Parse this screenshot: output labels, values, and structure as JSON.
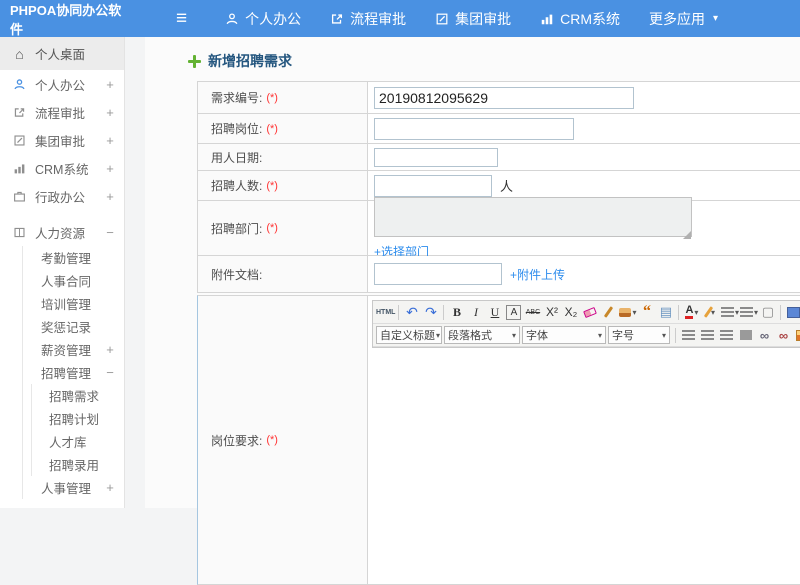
{
  "topbar": {
    "logo": "PHPOA协同办公软件",
    "nav": [
      {
        "label": "个人办公"
      },
      {
        "label": "流程审批"
      },
      {
        "label": "集团审批"
      },
      {
        "label": "CRM系统"
      },
      {
        "label": "更多应用"
      }
    ]
  },
  "icons": {
    "hamburger": "≡",
    "caret": "▾",
    "home": "⌂",
    "book": "⟙"
  },
  "sidebar": {
    "items": [
      {
        "label": "个人桌面"
      },
      {
        "label": "个人办公",
        "expand": "+"
      },
      {
        "label": "流程审批",
        "expand": "+"
      },
      {
        "label": "集团审批",
        "expand": "+"
      },
      {
        "label": "CRM系统",
        "expand": "+"
      },
      {
        "label": "行政办公",
        "expand": "+"
      },
      {
        "label": "人力资源",
        "expand": "−"
      },
      {
        "label": "考勤管理"
      },
      {
        "label": "人事合同"
      },
      {
        "label": "培训管理"
      },
      {
        "label": "奖惩记录"
      },
      {
        "label": "薪资管理",
        "expand": "+"
      },
      {
        "label": "招聘管理",
        "expand": "−"
      },
      {
        "label": "招聘需求"
      },
      {
        "label": "招聘计划"
      },
      {
        "label": "人才库"
      },
      {
        "label": "招聘录用"
      },
      {
        "label": "人事管理",
        "expand": "+"
      }
    ]
  },
  "page": {
    "title": "新增招聘需求"
  },
  "form": {
    "rows": [
      {
        "label": "需求编号:",
        "req": "(*)",
        "value": "20190812095629"
      },
      {
        "label": "招聘岗位:",
        "req": "(*)"
      },
      {
        "label": "用人日期:"
      },
      {
        "label": "招聘人数:",
        "req": "(*)",
        "suffix": "人"
      },
      {
        "label": "招聘部门:",
        "req": "(*)",
        "link": "+选择部门"
      },
      {
        "label": "附件文档:",
        "link": "+附件上传"
      },
      {
        "label": "岗位要求:",
        "req": "(*)"
      }
    ]
  },
  "editor": {
    "dropdowns": [
      {
        "label": "自定义标题"
      },
      {
        "label": "段落格式"
      },
      {
        "label": "字体"
      },
      {
        "label": "字号"
      }
    ],
    "icons": {
      "html": "HTML",
      "undo": "↶",
      "redo": "↷",
      "bold": "B",
      "italic": "I",
      "underline": "U",
      "fontbox": "A",
      "strike": "ABC",
      "sup": "X²",
      "sub": "X₂",
      "quote": "“",
      "template": "▤",
      "forecolor": "A",
      "page": "▢",
      "link": "∞",
      "unlink": "∞"
    }
  },
  "colors": {
    "topbar_blue": "#4a91e2",
    "title_navy": "#24567f",
    "required_red": "#ff3333",
    "link_blue": "#2e8ded",
    "row7_border_blue": "#a5c6e0"
  }
}
